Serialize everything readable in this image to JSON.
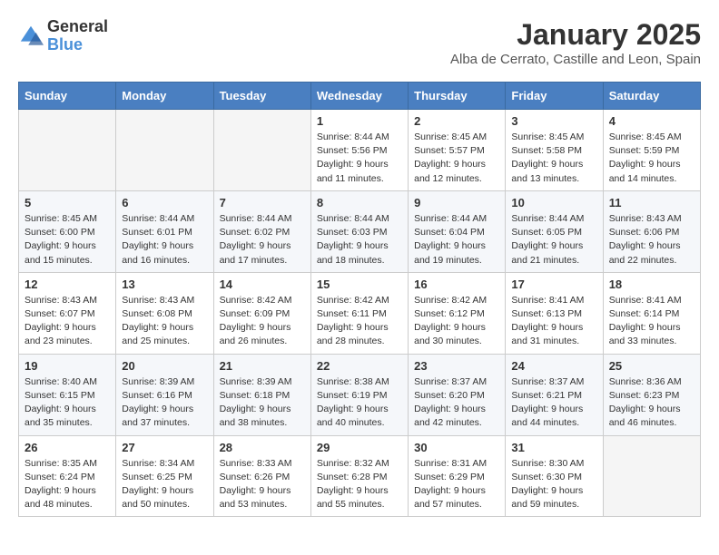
{
  "header": {
    "logo_general": "General",
    "logo_blue": "Blue",
    "month_year": "January 2025",
    "location": "Alba de Cerrato, Castille and Leon, Spain"
  },
  "weekdays": [
    "Sunday",
    "Monday",
    "Tuesday",
    "Wednesday",
    "Thursday",
    "Friday",
    "Saturday"
  ],
  "weeks": [
    [
      {
        "day": "",
        "info": ""
      },
      {
        "day": "",
        "info": ""
      },
      {
        "day": "",
        "info": ""
      },
      {
        "day": "1",
        "info": "Sunrise: 8:44 AM\nSunset: 5:56 PM\nDaylight: 9 hours\nand 11 minutes."
      },
      {
        "day": "2",
        "info": "Sunrise: 8:45 AM\nSunset: 5:57 PM\nDaylight: 9 hours\nand 12 minutes."
      },
      {
        "day": "3",
        "info": "Sunrise: 8:45 AM\nSunset: 5:58 PM\nDaylight: 9 hours\nand 13 minutes."
      },
      {
        "day": "4",
        "info": "Sunrise: 8:45 AM\nSunset: 5:59 PM\nDaylight: 9 hours\nand 14 minutes."
      }
    ],
    [
      {
        "day": "5",
        "info": "Sunrise: 8:45 AM\nSunset: 6:00 PM\nDaylight: 9 hours\nand 15 minutes."
      },
      {
        "day": "6",
        "info": "Sunrise: 8:44 AM\nSunset: 6:01 PM\nDaylight: 9 hours\nand 16 minutes."
      },
      {
        "day": "7",
        "info": "Sunrise: 8:44 AM\nSunset: 6:02 PM\nDaylight: 9 hours\nand 17 minutes."
      },
      {
        "day": "8",
        "info": "Sunrise: 8:44 AM\nSunset: 6:03 PM\nDaylight: 9 hours\nand 18 minutes."
      },
      {
        "day": "9",
        "info": "Sunrise: 8:44 AM\nSunset: 6:04 PM\nDaylight: 9 hours\nand 19 minutes."
      },
      {
        "day": "10",
        "info": "Sunrise: 8:44 AM\nSunset: 6:05 PM\nDaylight: 9 hours\nand 21 minutes."
      },
      {
        "day": "11",
        "info": "Sunrise: 8:43 AM\nSunset: 6:06 PM\nDaylight: 9 hours\nand 22 minutes."
      }
    ],
    [
      {
        "day": "12",
        "info": "Sunrise: 8:43 AM\nSunset: 6:07 PM\nDaylight: 9 hours\nand 23 minutes."
      },
      {
        "day": "13",
        "info": "Sunrise: 8:43 AM\nSunset: 6:08 PM\nDaylight: 9 hours\nand 25 minutes."
      },
      {
        "day": "14",
        "info": "Sunrise: 8:42 AM\nSunset: 6:09 PM\nDaylight: 9 hours\nand 26 minutes."
      },
      {
        "day": "15",
        "info": "Sunrise: 8:42 AM\nSunset: 6:11 PM\nDaylight: 9 hours\nand 28 minutes."
      },
      {
        "day": "16",
        "info": "Sunrise: 8:42 AM\nSunset: 6:12 PM\nDaylight: 9 hours\nand 30 minutes."
      },
      {
        "day": "17",
        "info": "Sunrise: 8:41 AM\nSunset: 6:13 PM\nDaylight: 9 hours\nand 31 minutes."
      },
      {
        "day": "18",
        "info": "Sunrise: 8:41 AM\nSunset: 6:14 PM\nDaylight: 9 hours\nand 33 minutes."
      }
    ],
    [
      {
        "day": "19",
        "info": "Sunrise: 8:40 AM\nSunset: 6:15 PM\nDaylight: 9 hours\nand 35 minutes."
      },
      {
        "day": "20",
        "info": "Sunrise: 8:39 AM\nSunset: 6:16 PM\nDaylight: 9 hours\nand 37 minutes."
      },
      {
        "day": "21",
        "info": "Sunrise: 8:39 AM\nSunset: 6:18 PM\nDaylight: 9 hours\nand 38 minutes."
      },
      {
        "day": "22",
        "info": "Sunrise: 8:38 AM\nSunset: 6:19 PM\nDaylight: 9 hours\nand 40 minutes."
      },
      {
        "day": "23",
        "info": "Sunrise: 8:37 AM\nSunset: 6:20 PM\nDaylight: 9 hours\nand 42 minutes."
      },
      {
        "day": "24",
        "info": "Sunrise: 8:37 AM\nSunset: 6:21 PM\nDaylight: 9 hours\nand 44 minutes."
      },
      {
        "day": "25",
        "info": "Sunrise: 8:36 AM\nSunset: 6:23 PM\nDaylight: 9 hours\nand 46 minutes."
      }
    ],
    [
      {
        "day": "26",
        "info": "Sunrise: 8:35 AM\nSunset: 6:24 PM\nDaylight: 9 hours\nand 48 minutes."
      },
      {
        "day": "27",
        "info": "Sunrise: 8:34 AM\nSunset: 6:25 PM\nDaylight: 9 hours\nand 50 minutes."
      },
      {
        "day": "28",
        "info": "Sunrise: 8:33 AM\nSunset: 6:26 PM\nDaylight: 9 hours\nand 53 minutes."
      },
      {
        "day": "29",
        "info": "Sunrise: 8:32 AM\nSunset: 6:28 PM\nDaylight: 9 hours\nand 55 minutes."
      },
      {
        "day": "30",
        "info": "Sunrise: 8:31 AM\nSunset: 6:29 PM\nDaylight: 9 hours\nand 57 minutes."
      },
      {
        "day": "31",
        "info": "Sunrise: 8:30 AM\nSunset: 6:30 PM\nDaylight: 9 hours\nand 59 minutes."
      },
      {
        "day": "",
        "info": ""
      }
    ]
  ]
}
